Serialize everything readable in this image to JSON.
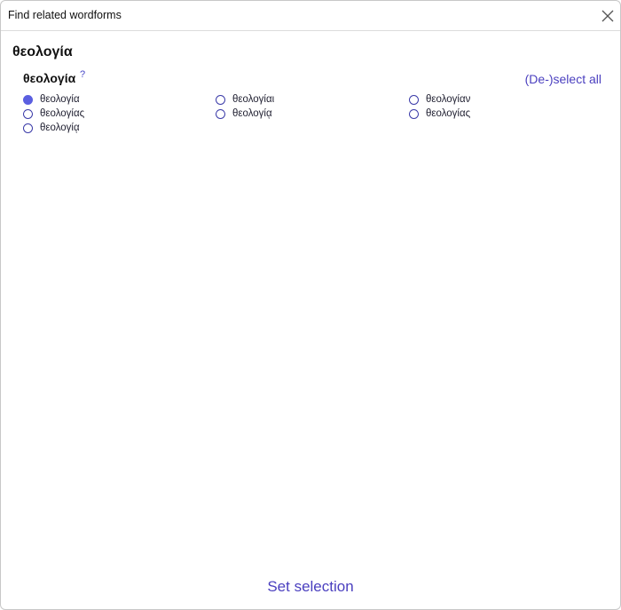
{
  "dialog": {
    "title": "Find related wordforms",
    "close_icon": "close-icon"
  },
  "word": {
    "heading": "θεολογία"
  },
  "group": {
    "lemma": "θεολογία",
    "help": "?",
    "deselect_all": "(De-)select all"
  },
  "options": [
    {
      "label": "θεολογία",
      "selected": true
    },
    {
      "label": "θεολογίαι",
      "selected": false
    },
    {
      "label": "θεολογίαν",
      "selected": false
    },
    {
      "label": "θεολογίας",
      "selected": false
    },
    {
      "label": "θεολογίᾳ",
      "selected": false
    },
    {
      "label": "θεολογίας",
      "selected": false
    },
    {
      "label": "θεολογίᾳ",
      "selected": false
    }
  ],
  "footer": {
    "set_selection": "Set selection"
  }
}
